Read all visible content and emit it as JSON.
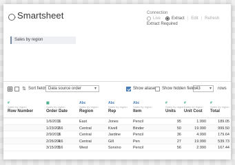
{
  "header": {
    "title": "Smartsheet",
    "connection_label": "Connection",
    "live_label": "Live",
    "extract_label": "Extract",
    "edit_label": "Edit",
    "refresh_label": "Refresh",
    "extract_status": "Extract Required"
  },
  "canvas": {
    "table_name": "Sales by region"
  },
  "toolbar": {
    "sort_label": "Sort fields",
    "sort_value": "Data source order",
    "show_aliases_label": "Show aliases",
    "show_aliases_checked": true,
    "show_hidden_label": "Show hidden fields",
    "show_hidden_checked": false,
    "rows_value": "43",
    "rows_label": "rows"
  },
  "grid": {
    "source_text": "Sales by region",
    "columns": [
      {
        "type": "#",
        "name": "Row Number"
      },
      {
        "type": "date",
        "name": "Order Date"
      },
      {
        "type": "Abc",
        "name": "Region"
      },
      {
        "type": "Abc",
        "name": "Rep"
      },
      {
        "type": "Abc",
        "name": "Item"
      },
      {
        "type": "#",
        "name": "Units"
      },
      {
        "type": "#",
        "name": "Unit Cost"
      },
      {
        "type": "#",
        "name": "Total"
      }
    ],
    "rows": [
      [
        "1",
        "1/6/2016",
        "East",
        "Jones",
        "Pencil",
        "95",
        "1.990",
        "189.05"
      ],
      [
        "2",
        "1/23/2016",
        "Central",
        "Kivell",
        "Binder",
        "50",
        "19.990",
        "999.50"
      ],
      [
        "3",
        "2/9/2016",
        "Central",
        "Jardine",
        "Pencil",
        "36",
        "4.990",
        "179.64"
      ],
      [
        "4",
        "2/26/2016",
        "Central",
        "Gill",
        "Pen",
        "27",
        "19.990",
        "539.73"
      ],
      [
        "5",
        "3/15/2016",
        "West",
        "Sorvino",
        "Pencil",
        "56",
        "2.990",
        "167.44"
      ]
    ]
  }
}
